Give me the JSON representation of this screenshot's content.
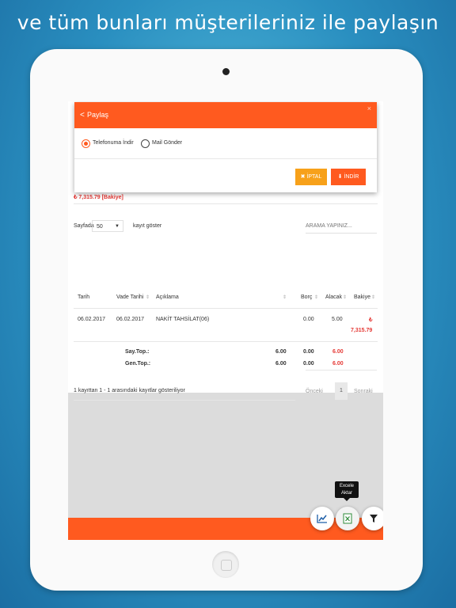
{
  "headline": "ve tüm bunları müşterileriniz ile paylaşın",
  "modal": {
    "title": "Paylaş",
    "close": "×",
    "options": [
      "Telefonuma İndir",
      "Mail Gönder"
    ],
    "selected_option": "Telefonuma İndir",
    "cancel_label": "✖ İPTAL",
    "download_label": "⬇ İNDİR"
  },
  "balance": "₺ 7,315.79 [Bakiye]",
  "table_controls": {
    "show_prefix": "Sayfada",
    "page_size": "50",
    "show_suffix": "kayıt göster",
    "search_placeholder": "ARAMA YAPINIZ..."
  },
  "table": {
    "headers": [
      "Tarih",
      "Vade Tarihi",
      "Açıklama",
      "Borç",
      "Alacak",
      "Bakiye"
    ],
    "rows": [
      {
        "tarih": "06.02.2017",
        "vade": "06.02.2017",
        "aciklama": "NAKİT TAHSİLAT(06)",
        "borc": "0.00",
        "alacak": "5.00",
        "bakiye_symbol": "₺",
        "bakiye": "7,315.79"
      }
    ],
    "totals": [
      {
        "label": "Say.Top.:",
        "col1": "6.00",
        "col2": "0.00",
        "col3": "6.00"
      },
      {
        "label": "Gen.Top.:",
        "col1": "6.00",
        "col2": "0.00",
        "col3": "6.00"
      }
    ]
  },
  "footer": {
    "info": "1 kayıttan 1 - 1 arasındaki kayıtlar gösteriliyor",
    "prev": "Önceki",
    "page": "1",
    "next": "Sonraki"
  },
  "tooltip": "Excele Aktar",
  "colors": {
    "accent": "#ff5a1f",
    "warning": "#f7a11a",
    "negative": "#e53935"
  },
  "fab_icons": [
    "chart-icon",
    "excel-icon",
    "filter-icon",
    "back-icon"
  ]
}
